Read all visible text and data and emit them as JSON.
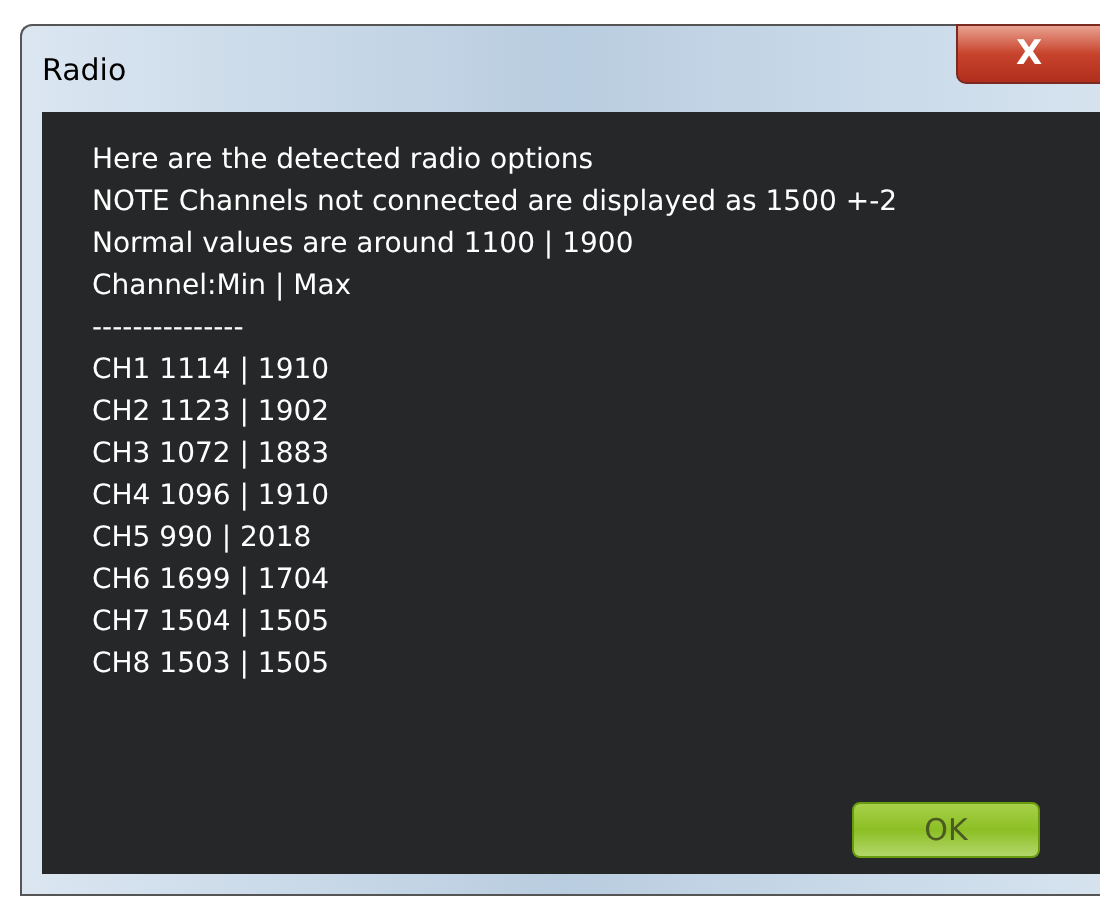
{
  "window": {
    "title": "Radio",
    "close": "X"
  },
  "lines": [
    "Here are the detected radio options",
    "NOTE Channels not connected are displayed as 1500 +-2",
    "Normal values are around 1100 | 1900",
    "Channel:Min | Max",
    "---------------",
    "CH1 1114 | 1910",
    "CH2 1123 | 1902",
    "CH3 1072 | 1883",
    "CH4 1096 | 1910",
    "CH5 990 | 2018",
    "CH6 1699 | 1704",
    "CH7 1504 | 1505",
    "CH8 1503 | 1505"
  ],
  "buttons": [
    "OK"
  ]
}
